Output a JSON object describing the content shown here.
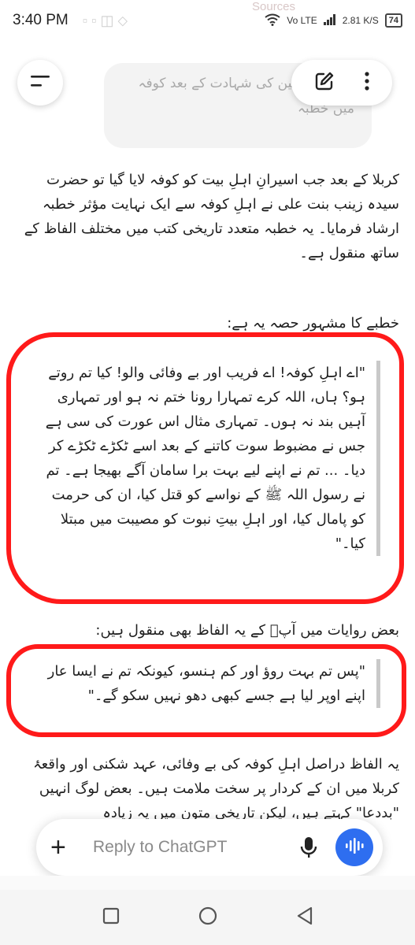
{
  "status_bar": {
    "time": "3:40 PM",
    "network": "Vo LTE",
    "speed": "2.81 K/S",
    "battery": "74",
    "watermark": "Sources"
  },
  "header": {
    "chat_title": "کا امام حسین کی شہادت کے بعد کوفہ میں خطبہ"
  },
  "content": {
    "intro": "کربلا کے بعد جب اسیرانِ اہلِ بیت کو کوفہ لایا گیا تو حضرت سیدہ زینب بنت علی نے اہلِ کوفہ سے ایک نہایت مؤثر خطبہ ارشاد فرمایا۔ یہ خطبہ متعدد تاریخی کتب میں مختلف الفاظ کے ساتھ منقول ہے۔",
    "lead": "خطبے کا مشہور حصہ یہ ہے:",
    "quote1": "\"اے اہلِ کوفہ! اے فریب اور بے وفائی والو! کیا تم روتے ہو؟ ہاں، اللہ کرے تمہارا رونا ختم نہ ہو اور تمہاری آہیں بند نہ ہوں۔ تمہاری مثال اس عورت کی سی ہے جس نے مضبوط سوت کاتنے کے بعد اسے ٹکڑے ٹکڑے کر دیا۔ ... تم نے اپنے لیے بہت برا سامان آگے بھیجا ہے۔ تم نے رسول اللہ ﷺ کے نواسے کو قتل کیا، ان کی حرمت کو پامال کیا، اور اہلِ بیتِ نبوت کو مصیبت میں مبتلا کیا۔\"",
    "lead2": "بعض روایات میں آپؑ کے یہ الفاظ بھی منقول ہیں:",
    "quote2": "\"پس تم بہت روؤ اور کم ہنسو، کیونکہ تم نے ایسا عار اپنے اوپر لیا ہے جسے کبھی دھو نہیں سکو گے۔\"",
    "outro": "یہ الفاظ دراصل اہلِ کوفہ کی بے وفائی، عہد شکنی اور واقعۂ کربلا میں ان کے کردار پر سخت ملامت ہیں۔ بعض لوگ انہیں \"بددعا\" کہتے ہیں، لیکن تاریخی متون میں یہ زیادہ"
  },
  "composer": {
    "placeholder": "Reply to ChatGPT"
  },
  "icons": {
    "menu": "menu-icon",
    "edit": "edit-icon",
    "more": "more-vertical-icon",
    "plus": "plus-icon",
    "mic": "mic-icon",
    "voice": "voice-wave-icon",
    "back": "back-nav-icon",
    "home": "home-nav-icon",
    "recents": "recents-nav-icon"
  },
  "colors": {
    "accent": "#2e6ef0",
    "annotation": "#ff1a1a"
  }
}
